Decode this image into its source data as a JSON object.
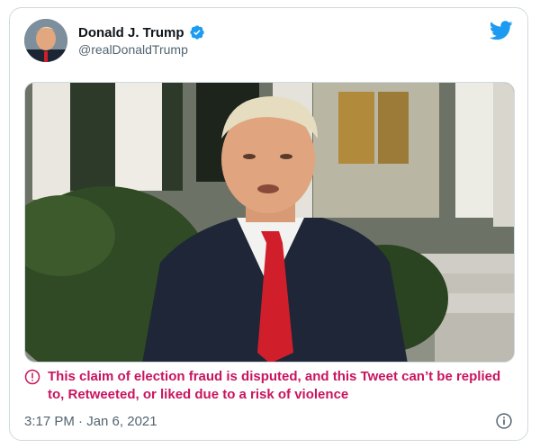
{
  "author": {
    "display_name": "Donald J. Trump",
    "handle": "@realDonaldTrump",
    "verified": true
  },
  "media": {
    "type": "video-thumbnail"
  },
  "notice": {
    "text": "This claim of election fraud is disputed, and this Tweet can’t be replied to, Retweeted, or liked due to a risk of violence",
    "color": "#c9145f"
  },
  "footer": {
    "timestamp": "3:17 PM · Jan 6, 2021"
  },
  "icons": {
    "brand": "twitter-bird-icon",
    "verified": "verified-badge-icon",
    "notice": "alert-circle-icon",
    "info": "info-icon"
  },
  "colors": {
    "brand_blue": "#1d9bf0",
    "text_primary": "#0f1419",
    "text_secondary": "#536471"
  }
}
